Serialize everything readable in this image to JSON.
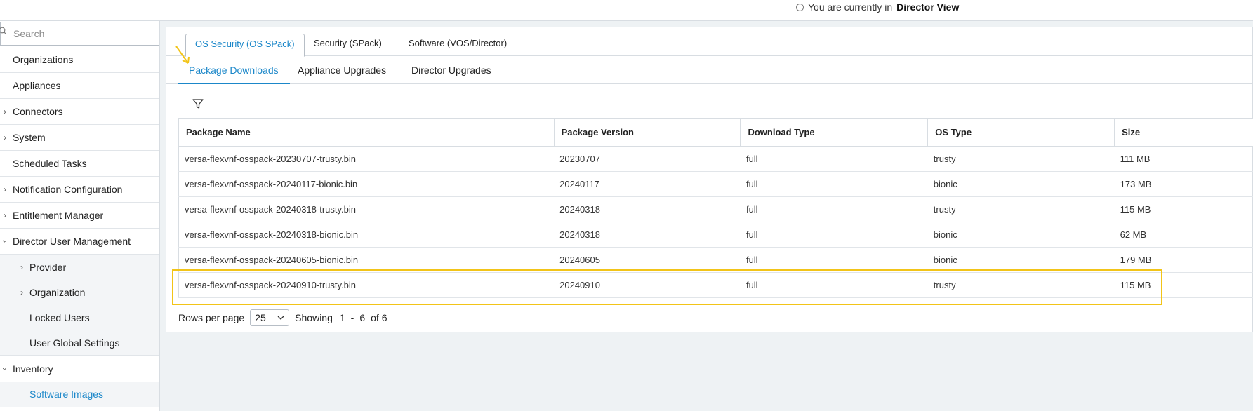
{
  "header": {
    "view_prefix": "You are currently in",
    "view_name": "Director View"
  },
  "search": {
    "placeholder": "Search"
  },
  "sidebar": {
    "items": [
      {
        "label": "Organizations"
      },
      {
        "label": "Appliances"
      },
      {
        "label": "Connectors"
      },
      {
        "label": "System"
      },
      {
        "label": "Scheduled Tasks"
      },
      {
        "label": "Notification Configuration"
      },
      {
        "label": "Entitlement Manager"
      },
      {
        "label": "Director User Management"
      },
      {
        "label": "Provider"
      },
      {
        "label": "Organization"
      },
      {
        "label": "Locked Users"
      },
      {
        "label": "User Global Settings"
      },
      {
        "label": "Inventory"
      },
      {
        "label": "Software Images"
      }
    ]
  },
  "tabs_primary": [
    {
      "label": "OS Security (OS SPack)"
    },
    {
      "label": "Security (SPack)"
    },
    {
      "label": "Software (VOS/Director)"
    }
  ],
  "tabs_secondary": [
    {
      "label": "Package Downloads"
    },
    {
      "label": "Appliance Upgrades"
    },
    {
      "label": "Director Upgrades"
    }
  ],
  "table": {
    "columns": [
      "Package Name",
      "Package Version",
      "Download Type",
      "OS Type",
      "Size"
    ],
    "rows": [
      [
        "versa-flexvnf-osspack-20230707-trusty.bin",
        "20230707",
        "full",
        "trusty",
        "111 MB"
      ],
      [
        "versa-flexvnf-osspack-20240117-bionic.bin",
        "20240117",
        "full",
        "bionic",
        "173 MB"
      ],
      [
        "versa-flexvnf-osspack-20240318-trusty.bin",
        "20240318",
        "full",
        "trusty",
        "115 MB"
      ],
      [
        "versa-flexvnf-osspack-20240318-bionic.bin",
        "20240318",
        "full",
        "bionic",
        "62 MB"
      ],
      [
        "versa-flexvnf-osspack-20240605-bionic.bin",
        "20240605",
        "full",
        "bionic",
        "179 MB"
      ],
      [
        "versa-flexvnf-osspack-20240910-trusty.bin",
        "20240910",
        "full",
        "trusty",
        "115 MB"
      ]
    ]
  },
  "pager": {
    "rows_per_page_label": "Rows per page",
    "rows_per_page_value": "25",
    "showing_label": "Showing",
    "range_start": "1",
    "range_sep": "-",
    "range_end": "6",
    "total_label": "of 6"
  },
  "colors": {
    "accent": "#1b87c9",
    "highlight": "#f2c418"
  }
}
